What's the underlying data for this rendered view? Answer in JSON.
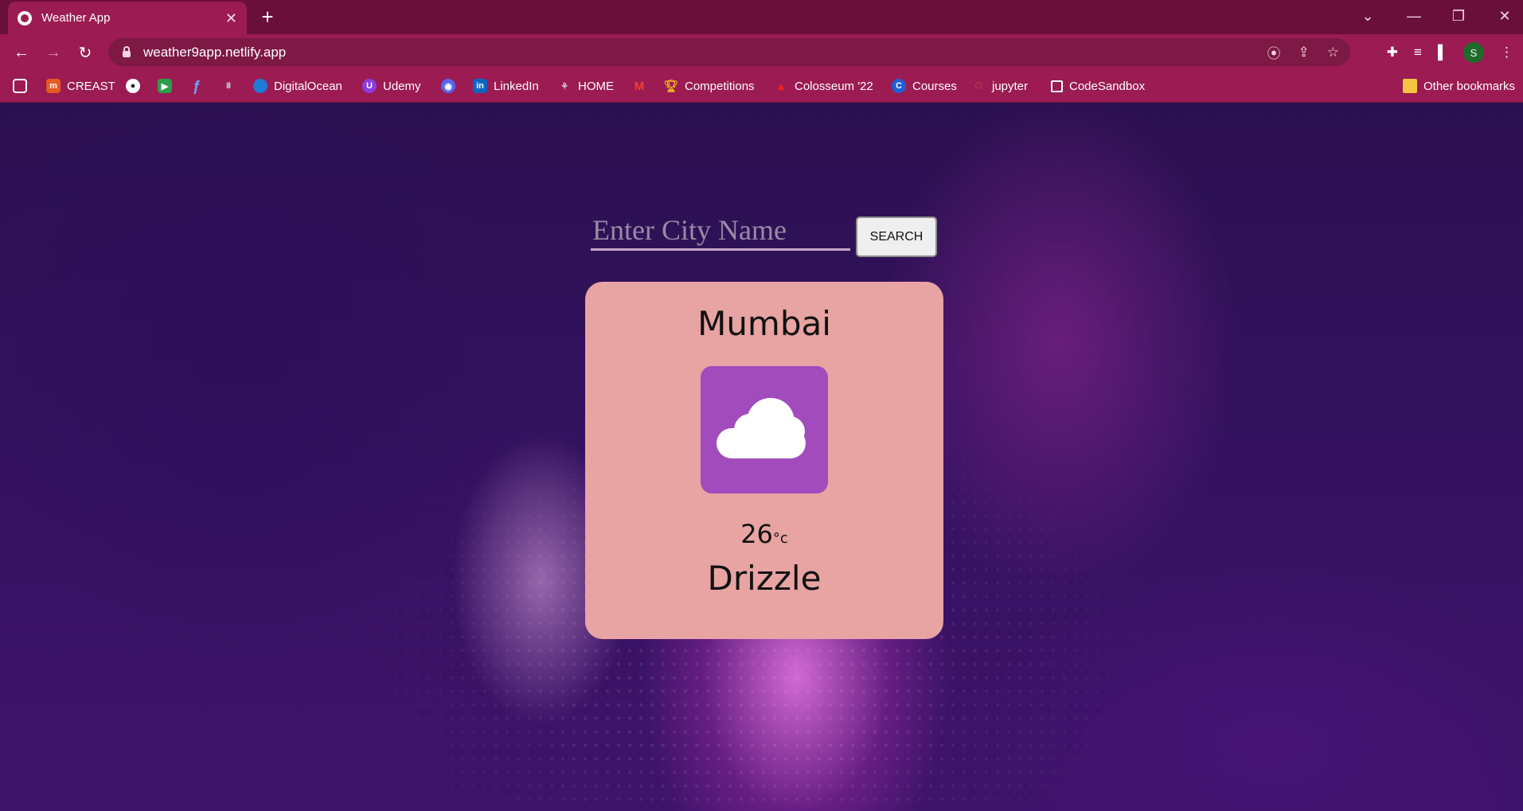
{
  "browser": {
    "tab": {
      "title": "Weather App",
      "favicon": "globe-icon"
    },
    "url": "weather9app.netlify.app",
    "profile_initial": "S",
    "colors": {
      "titlebar": "#6a0f3a",
      "toolbar": "#9b1b52",
      "omnibox": "#7e1845"
    }
  },
  "bookmarks": {
    "items": [
      {
        "label": "",
        "icon": "apps-icon"
      },
      {
        "label": "CREAST",
        "icon": "creast-icon"
      },
      {
        "label": "",
        "icon": "github-icon"
      },
      {
        "label": "",
        "icon": "meet-icon"
      },
      {
        "label": "",
        "icon": "arc-icon"
      },
      {
        "label": "",
        "icon": "team-icon"
      },
      {
        "label": "DigitalOcean",
        "icon": "digitalocean-icon"
      },
      {
        "label": "Udemy",
        "icon": "udemy-icon"
      },
      {
        "label": "",
        "icon": "discord-icon"
      },
      {
        "label": "LinkedIn",
        "icon": "linkedin-icon"
      },
      {
        "label": "HOME",
        "icon": "home-icon"
      },
      {
        "label": "",
        "icon": "gmail-icon"
      },
      {
        "label": "Competitions",
        "icon": "trophy-icon"
      },
      {
        "label": "Colosseum '22",
        "icon": "colosseum-icon"
      },
      {
        "label": "Courses",
        "icon": "courses-icon"
      },
      {
        "label": "jupyter",
        "icon": "jupyter-icon"
      },
      {
        "label": "CodeSandbox",
        "icon": "codesandbox-icon"
      }
    ],
    "other_label": "Other bookmarks"
  },
  "app": {
    "search": {
      "placeholder": "Enter City Name",
      "value": "",
      "button_label": "SEARCH"
    },
    "weather": {
      "city": "Mumbai",
      "icon": "cloud-icon",
      "temperature": "26",
      "unit": "°c",
      "condition": "Drizzle"
    },
    "colors": {
      "card": "#e8a3a3",
      "icon_box": "#a24bbd",
      "input_underline": "#c8a6c8"
    }
  }
}
